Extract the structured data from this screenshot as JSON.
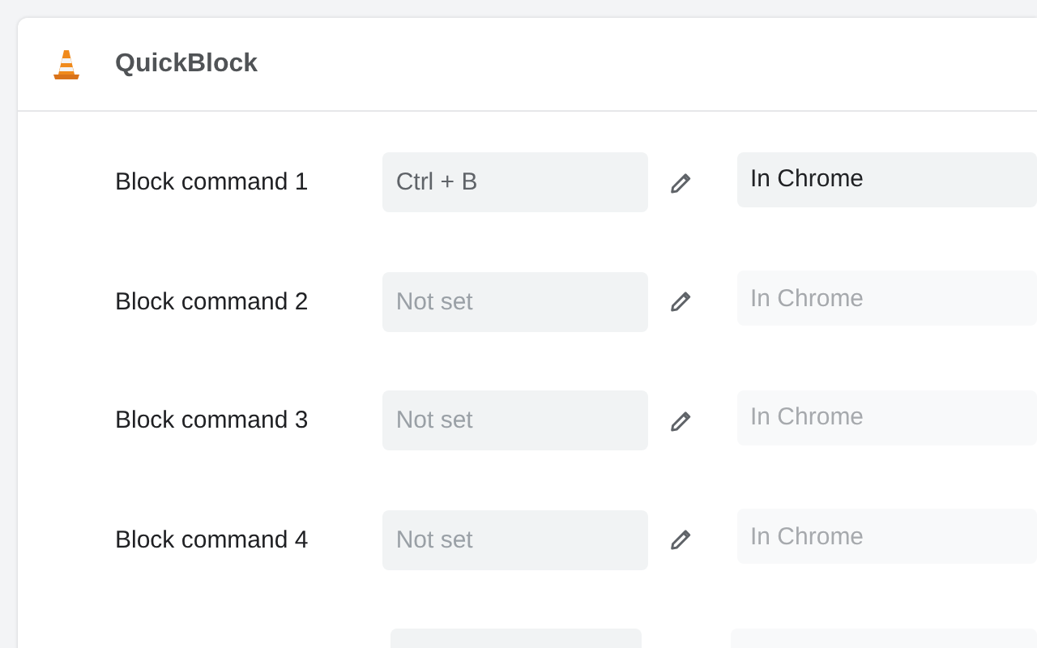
{
  "header": {
    "title": "QuickBlock"
  },
  "commands": [
    {
      "kind": "full",
      "label": "Block command 1",
      "shortcut": {
        "value": "Ctrl + B"
      },
      "scope": {
        "value": "In Chrome",
        "disabled": false
      }
    },
    {
      "kind": "full",
      "label": "Block command 2",
      "shortcut": {
        "placeholder": "Not set"
      },
      "scope": {
        "value": "In Chrome",
        "disabled": true
      }
    },
    {
      "kind": "full",
      "label": "Block command 3",
      "shortcut": {
        "placeholder": "Not set"
      },
      "scope": {
        "value": "In Chrome",
        "disabled": true
      }
    },
    {
      "kind": "full",
      "label": "Block command 4",
      "shortcut": {
        "placeholder": "Not set"
      },
      "scope": {
        "value": "In Chrome",
        "disabled": true
      }
    },
    {
      "kind": "cut_off"
    }
  ]
}
